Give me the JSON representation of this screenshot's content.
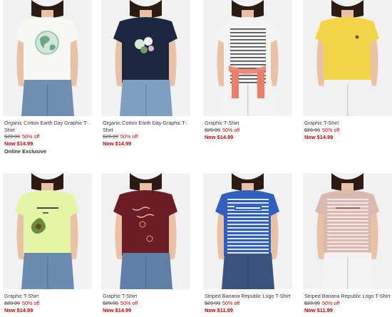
{
  "products": [
    {
      "name": "Organic Cotton Earth Day Graphic T-Shirt",
      "was": "$29.99",
      "off": "50% off",
      "now": "Now $14.99",
      "tag": "Online Exclusive",
      "shirt": "#f7f7f4",
      "graphic": "globe",
      "pants": "#6f8fb2"
    },
    {
      "name": "Organic Cotton Earth Day Graphic T-Shirt",
      "was": "$29.99",
      "off": "50% off",
      "now": "Now $14.99",
      "tag": "",
      "shirt": "#1c2741",
      "graphic": "flowers",
      "pants": "#7f9fc2"
    },
    {
      "name": "Graphic T-Shirt",
      "was": "$29.99",
      "off": "50% off",
      "now": "Now $14.99",
      "tag": "",
      "shirt": "#f4f4f4",
      "graphic": "stripes",
      "pants": "#f3f3f3"
    },
    {
      "name": "Graphic T-Shirt",
      "was": "$29.99",
      "off": "50% off",
      "now": "Now $14.99",
      "tag": "",
      "shirt": "#f3d448",
      "graphic": "tiny",
      "pants": "#f1f1f1"
    },
    {
      "name": "Graphic T-Shirt",
      "was": "$29.99",
      "off": "50% off",
      "now": "Now $14.99",
      "tag": "",
      "shirt": "#e4f5a6",
      "graphic": "avocado",
      "pants": "#6b8bb0"
    },
    {
      "name": "Graphic T-Shirt",
      "was": "$29.99",
      "off": "50% off",
      "now": "Now $14.99",
      "tag": "",
      "shirt": "#6b1c24",
      "graphic": "script",
      "pants": "#5f7fa8"
    },
    {
      "name": "Striped Banana Republic Logo T-Shirt",
      "was": "$23.99",
      "off": "50% off",
      "now": "Now $11.99",
      "tag": "",
      "shirt": "#2f5fbf",
      "graphic": "bluestripes",
      "pants": "#39557f"
    },
    {
      "name": "Striped Banana Republic Logo T-Shirt",
      "was": "$23.99",
      "off": "50% off",
      "now": "Now $11.99",
      "tag": "",
      "shirt": "#d9b9b0",
      "graphic": "pinkstripes",
      "pants": "#f4f4f4"
    }
  ]
}
